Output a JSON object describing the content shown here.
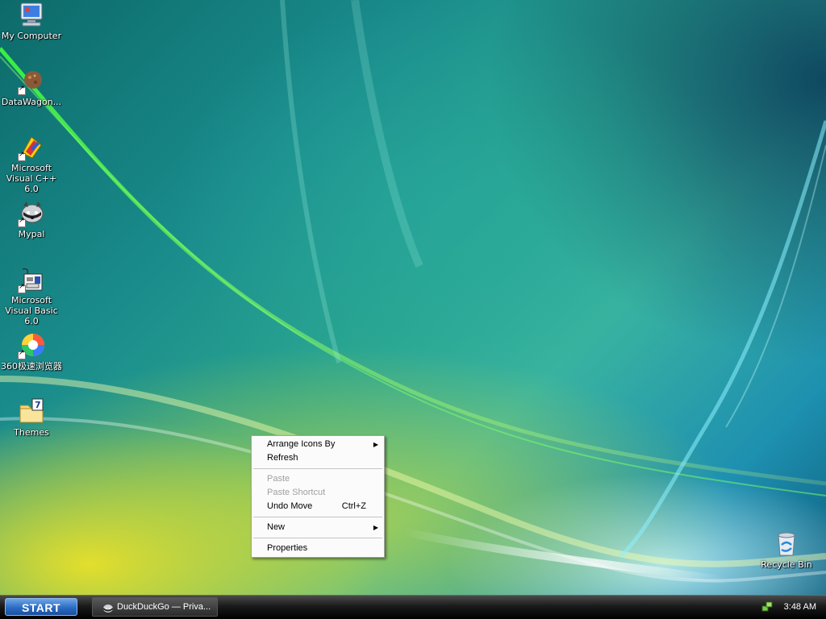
{
  "desktop": {
    "icons": [
      {
        "label": "My Computer",
        "icon": "my-computer-icon"
      },
      {
        "label": "DataWagon...",
        "icon": "datawagon-icon"
      },
      {
        "label": "Microsoft Visual C++ 6.0",
        "icon": "visual-cpp-icon"
      },
      {
        "label": "Mypal",
        "icon": "mypal-icon"
      },
      {
        "label": "Microsoft Visual Basic 6.0",
        "icon": "visual-basic-icon"
      },
      {
        "label": "360极速浏览器",
        "icon": "browser-360-icon"
      },
      {
        "label": "Themes",
        "icon": "themes-folder-icon"
      }
    ],
    "recycle_bin": {
      "label": "Recycle Bin",
      "icon": "recycle-bin-icon"
    }
  },
  "context_menu": {
    "arrange": "Arrange Icons By",
    "refresh": "Refresh",
    "paste": "Paste",
    "paste_shortcut": "Paste Shortcut",
    "undo_move": "Undo Move",
    "undo_shortcut": "Ctrl+Z",
    "new": "New",
    "properties": "Properties"
  },
  "taskbar": {
    "start_label": "START",
    "task_label": "DuckDuckGo — Priva...",
    "clock": "3:48 AM"
  }
}
